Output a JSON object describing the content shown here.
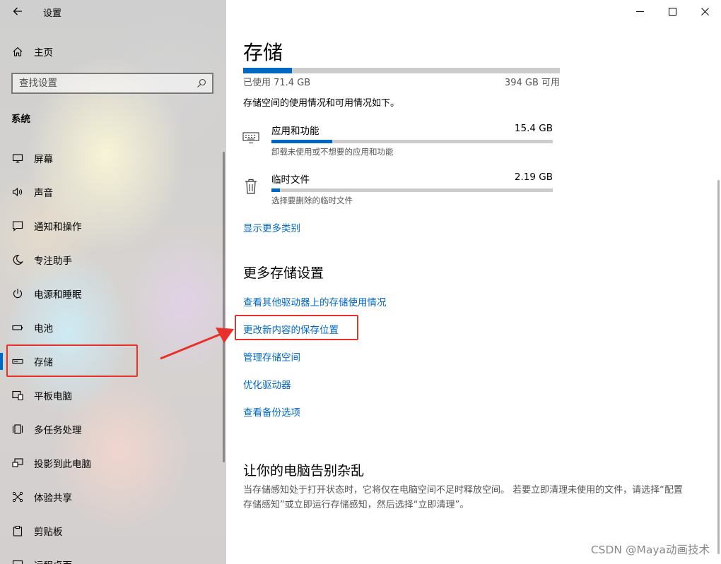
{
  "window": {
    "title": "设置"
  },
  "sidebar": {
    "home_label": "主页",
    "search_placeholder": "查找设置",
    "section_title": "系统",
    "items": [
      {
        "label": "屏幕",
        "icon": "monitor-icon"
      },
      {
        "label": "声音",
        "icon": "speaker-icon"
      },
      {
        "label": "通知和操作",
        "icon": "message-icon"
      },
      {
        "label": "专注助手",
        "icon": "moon-icon"
      },
      {
        "label": "电源和睡眠",
        "icon": "power-icon"
      },
      {
        "label": "电池",
        "icon": "battery-icon"
      },
      {
        "label": "存储",
        "icon": "storage-icon",
        "active": true
      },
      {
        "label": "平板电脑",
        "icon": "tablet-icon"
      },
      {
        "label": "多任务处理",
        "icon": "multitask-icon"
      },
      {
        "label": "投影到此电脑",
        "icon": "project-icon"
      },
      {
        "label": "体验共享",
        "icon": "share-icon"
      },
      {
        "label": "剪贴板",
        "icon": "clipboard-icon"
      },
      {
        "label": "远程桌面",
        "icon": "remote-desktop-icon"
      }
    ]
  },
  "main": {
    "title": "存储",
    "usage": {
      "used": "已使用 71.4 GB",
      "free": "394 GB 可用",
      "used_fraction": 0.153
    },
    "description": "存储空间的使用情况和可用情况如下。",
    "categories": [
      {
        "name": "应用和功能",
        "size": "15.4 GB",
        "subtitle": "卸载未使用或不想要的应用和功能",
        "fraction": 0.215,
        "icon": "keyboard-icon"
      },
      {
        "name": "临时文件",
        "size": "2.19 GB",
        "subtitle": "选择要删除的临时文件",
        "fraction": 0.03,
        "icon": "trash-icon"
      }
    ],
    "show_more": "显示更多类别",
    "more_settings_heading": "更多存储设置",
    "more_settings_links": [
      "查看其他驱动器上的存储使用情况",
      "更改新内容的保存位置",
      "管理存储空间",
      "优化驱动器",
      "查看备份选项"
    ],
    "declutter_heading": "让你的电脑告别杂乱",
    "declutter_text": "当存储感知处于打开状态时，它将仅在电脑空间不足时释放空间。 若要立即清理未使用的文件，请选择“配置存储感知”或立即运行存储感知，然后选择“立即清理”。"
  },
  "annotation": {
    "color": "#e8312a"
  },
  "watermark": "CSDN @Maya动画技术",
  "colors": {
    "accent": "#0067c0",
    "annotation": "#e8312a"
  }
}
